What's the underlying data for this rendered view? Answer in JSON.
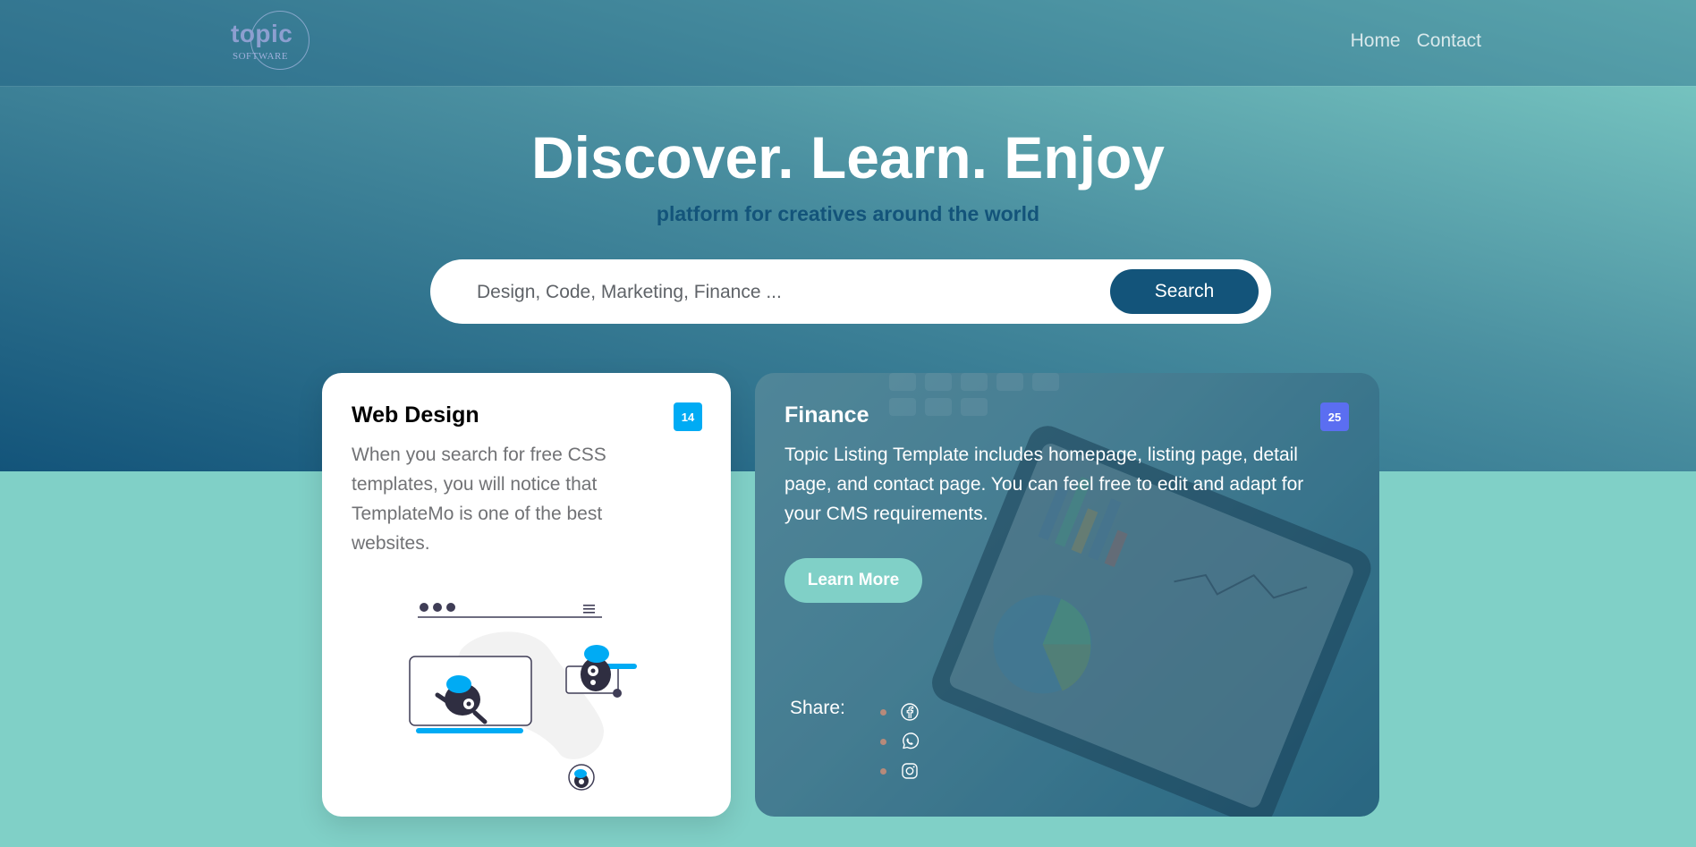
{
  "nav": {
    "logo_text": "topic",
    "logo_subtext": "SOFTWARE",
    "links": [
      "Home",
      "Contact"
    ]
  },
  "hero": {
    "title": "Discover. Learn. Enjoy",
    "subtitle": "platform for creatives around the world",
    "search": {
      "placeholder": "Design, Code, Marketing, Finance ...",
      "value": "",
      "button_label": "Search"
    }
  },
  "cards": {
    "web_design": {
      "title": "Web Design",
      "badge": "14",
      "description": "When you search for free CSS templates, you will notice that TemplateMo is one of the best websites."
    },
    "finance": {
      "title": "Finance",
      "badge": "25",
      "description": "Topic Listing Template includes homepage, listing page, detail page, and contact page. You can feel free to edit and adapt for your CMS requirements.",
      "button_label": "Learn More",
      "share_label": "Share:",
      "share_icons": [
        "facebook-icon",
        "whatsapp-icon",
        "instagram-icon"
      ]
    }
  },
  "colors": {
    "primary": "#13547a",
    "secondary": "#80d0c7",
    "badge_web": "#00abf4",
    "badge_finance": "#5b6ef1",
    "text_muted": "#717275"
  }
}
